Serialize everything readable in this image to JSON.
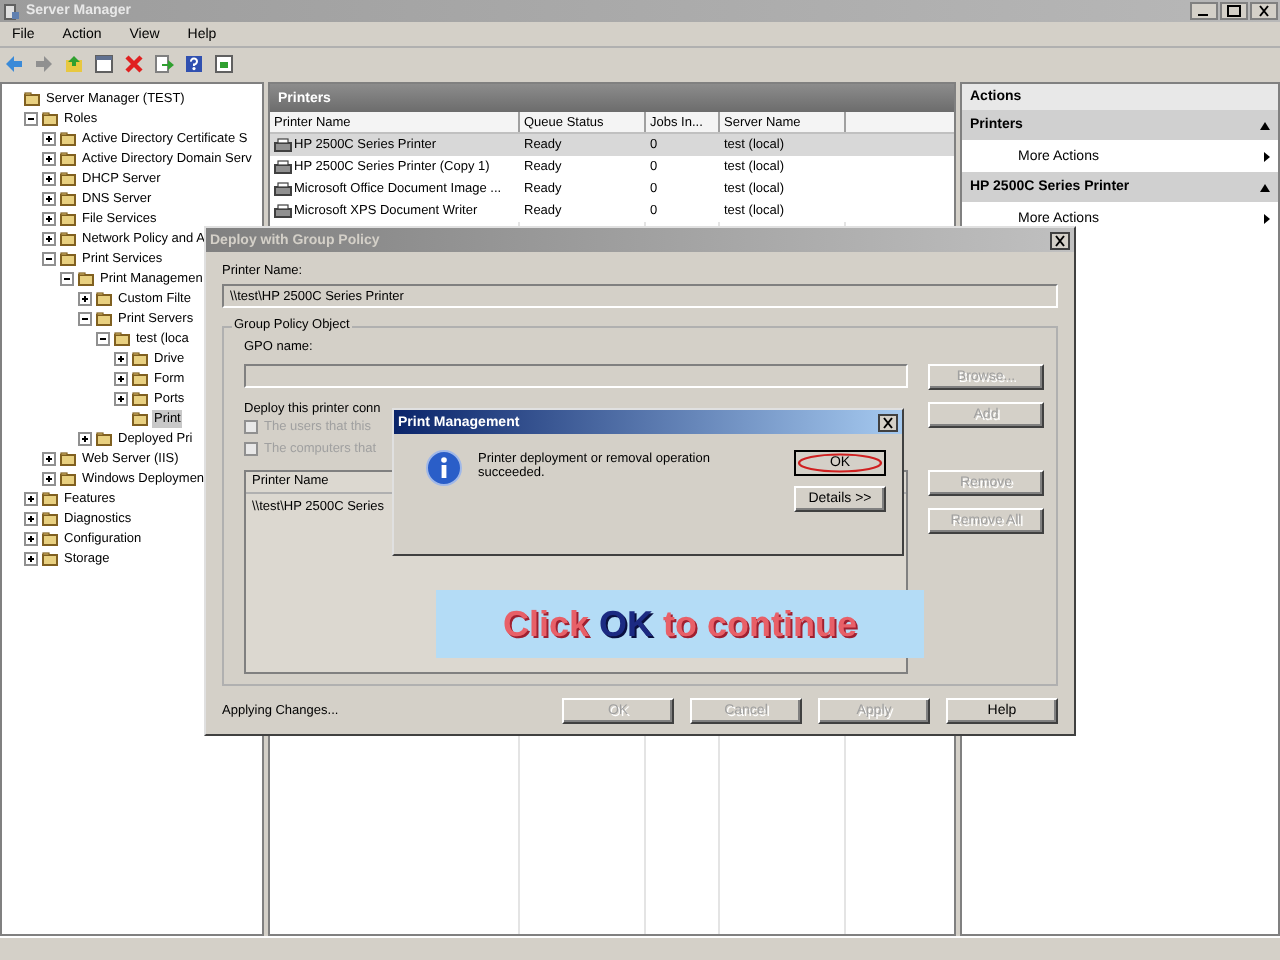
{
  "window": {
    "title": "Server Manager"
  },
  "menu": [
    "File",
    "Action",
    "View",
    "Help"
  ],
  "tree": [
    {
      "label": "Server Manager (TEST)",
      "selected": false,
      "children": [
        {
          "label": "Roles",
          "expanded": true,
          "selected": false,
          "children": [
            {
              "label": "Active Directory Certificate S",
              "expanded": false,
              "selected": false
            },
            {
              "label": "Active Directory Domain Serv",
              "expanded": false,
              "selected": false
            },
            {
              "label": "DHCP Server",
              "expanded": false,
              "selected": false
            },
            {
              "label": "DNS Server",
              "expanded": false,
              "selected": false
            },
            {
              "label": "File Services",
              "expanded": false,
              "selected": false
            },
            {
              "label": "Network Policy and A",
              "expanded": false,
              "selected": false
            },
            {
              "label": "Print Services",
              "expanded": true,
              "selected": false,
              "children": [
                {
                  "label": "Print Managemen",
                  "expanded": true,
                  "selected": false,
                  "children": [
                    {
                      "label": "Custom Filte",
                      "expanded": false,
                      "selected": false
                    },
                    {
                      "label": "Print Servers",
                      "expanded": true,
                      "selected": false,
                      "children": [
                        {
                          "label": "test (loca",
                          "expanded": true,
                          "selected": false,
                          "children": [
                            {
                              "label": "Drive",
                              "expanded": false,
                              "selected": false
                            },
                            {
                              "label": "Form",
                              "expanded": false,
                              "selected": false
                            },
                            {
                              "label": "Ports",
                              "expanded": false,
                              "selected": false
                            },
                            {
                              "label": "Print",
                              "selected": true
                            }
                          ]
                        }
                      ]
                    },
                    {
                      "label": "Deployed Pri",
                      "expanded": false,
                      "selected": false
                    }
                  ]
                }
              ]
            },
            {
              "label": "Web Server (IIS)",
              "expanded": false,
              "selected": false
            },
            {
              "label": "Windows Deploymen",
              "expanded": false,
              "selected": false
            }
          ]
        },
        {
          "label": "Features",
          "expanded": false,
          "selected": false
        },
        {
          "label": "Diagnostics",
          "expanded": false,
          "selected": false
        },
        {
          "label": "Configuration",
          "expanded": false,
          "selected": false
        },
        {
          "label": "Storage",
          "expanded": false,
          "selected": false
        }
      ]
    }
  ],
  "printers": {
    "title": "Printers",
    "columns": [
      "Printer Name",
      "Queue Status",
      "Jobs In...",
      "Server Name"
    ],
    "rows": [
      {
        "cells": [
          "HP 2500C Series Printer",
          "Ready",
          "0",
          "test (local)"
        ],
        "selected": true
      },
      {
        "cells": [
          "HP 2500C Series Printer (Copy 1)",
          "Ready",
          "0",
          "test (local)"
        ],
        "selected": false
      },
      {
        "cells": [
          "Microsoft Office Document Image ...",
          "Ready",
          "0",
          "test (local)"
        ],
        "selected": false
      },
      {
        "cells": [
          "Microsoft XPS Document Writer",
          "Ready",
          "0",
          "test (local)"
        ],
        "selected": false
      }
    ]
  },
  "actions": {
    "title": "Actions",
    "sections": [
      {
        "title": "Printers",
        "expanded": true,
        "items": [
          "More Actions"
        ]
      },
      {
        "title": "HP 2500C Series Printer",
        "expanded": true,
        "items": [
          "More Actions"
        ]
      }
    ]
  },
  "deploy_dialog": {
    "title": "Deploy with Group Policy",
    "printer_name_label": "Printer Name:",
    "printer_name": "\\\\test\\HP 2500C Series Printer",
    "group_title": "Group Policy Object",
    "gpo_label": "GPO name:",
    "browse_button": {
      "label": "Browse...",
      "disabled": true
    },
    "deploy_label": "Deploy this printer conn",
    "checkboxes": [
      {
        "label": "The users that this",
        "checked": false,
        "disabled": true
      },
      {
        "label": "The computers that",
        "checked": false,
        "disabled": true
      }
    ],
    "add_button": {
      "label": "Add",
      "disabled": true
    },
    "list_header": "Printer Name",
    "list_rows": [
      "\\\\test\\HP 2500C Series"
    ],
    "side_buttons": [
      {
        "label": "Remove",
        "disabled": true
      },
      {
        "label": "Remove All",
        "disabled": true
      }
    ],
    "status": "Applying Changes...",
    "buttons": [
      {
        "label": "OK",
        "disabled": true
      },
      {
        "label": "Cancel",
        "disabled": true
      },
      {
        "label": "Apply",
        "disabled": true
      },
      {
        "label": "Help",
        "disabled": false
      }
    ]
  },
  "message_box": {
    "title": "Print Management",
    "message": "Printer deployment or removal operation succeeded.",
    "buttons": [
      {
        "label": "OK",
        "highlighted": true
      },
      {
        "label": "Details >>",
        "highlighted": false
      }
    ]
  },
  "callout": {
    "parts": [
      {
        "text": "Click",
        "emphasis": false
      },
      {
        "text": "OK",
        "emphasis": true
      },
      {
        "text": "to continue",
        "emphasis": false
      }
    ]
  }
}
